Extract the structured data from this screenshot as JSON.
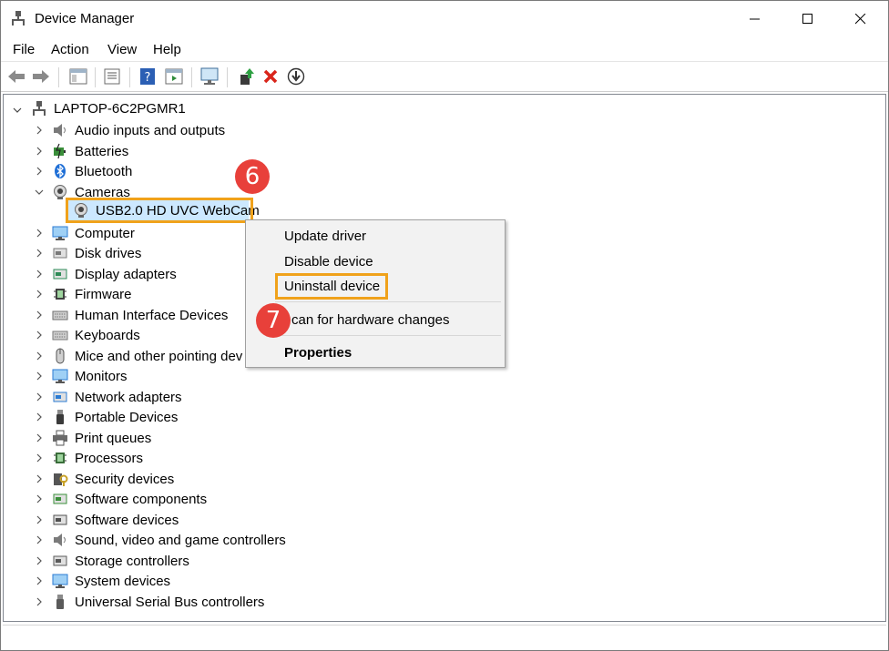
{
  "window": {
    "title": "Device Manager"
  },
  "menu": {
    "file": "File",
    "action": "Action",
    "view": "View",
    "help": "Help"
  },
  "toolbar_icons": [
    "back-icon",
    "forward-icon",
    "properties-icon",
    "console-tree-icon",
    "help-icon",
    "action-pane-icon",
    "scan-monitor-icon",
    "update-driver-icon",
    "uninstall-icon",
    "download-icon"
  ],
  "tree": {
    "root": "LAPTOP-6C2PGMR1",
    "categories": [
      {
        "label": "Audio inputs and outputs",
        "icon": "speaker-icon"
      },
      {
        "label": "Batteries",
        "icon": "battery-icon"
      },
      {
        "label": "Bluetooth",
        "icon": "bluetooth-icon"
      },
      {
        "label": "Cameras",
        "icon": "camera-icon",
        "expanded": true
      },
      {
        "label": "Computer",
        "icon": "computer-icon"
      },
      {
        "label": "Disk drives",
        "icon": "disk-icon"
      },
      {
        "label": "Display adapters",
        "icon": "display-adapter-icon"
      },
      {
        "label": "Firmware",
        "icon": "chip-icon"
      },
      {
        "label": "Human Interface Devices",
        "icon": "hid-icon"
      },
      {
        "label": "Keyboards",
        "icon": "keyboard-icon"
      },
      {
        "label": "Mice and other pointing dev",
        "icon": "mouse-icon"
      },
      {
        "label": "Monitors",
        "icon": "monitor-icon"
      },
      {
        "label": "Network adapters",
        "icon": "network-icon"
      },
      {
        "label": "Portable Devices",
        "icon": "portable-icon"
      },
      {
        "label": "Print queues",
        "icon": "printer-icon"
      },
      {
        "label": "Processors",
        "icon": "processor-icon"
      },
      {
        "label": "Security devices",
        "icon": "security-icon"
      },
      {
        "label": "Software components",
        "icon": "software-component-icon"
      },
      {
        "label": "Software devices",
        "icon": "software-device-icon"
      },
      {
        "label": "Sound, video and game controllers",
        "icon": "sound-icon"
      },
      {
        "label": "Storage controllers",
        "icon": "storage-icon"
      },
      {
        "label": "System devices",
        "icon": "system-icon"
      },
      {
        "label": "Universal Serial Bus controllers",
        "icon": "usb-icon"
      }
    ],
    "camera_child": "USB2.0 HD UVC WebCam"
  },
  "context_menu": {
    "update": "Update driver",
    "disable": "Disable device",
    "uninstall": "Uninstall device",
    "scan": "can for hardware changes",
    "properties": "Properties"
  },
  "annotations": {
    "step6": "6",
    "step7": "7"
  },
  "colors": {
    "highlight": "#f0a21b",
    "badge": "#e8403a",
    "selection": "#cce8ff"
  }
}
